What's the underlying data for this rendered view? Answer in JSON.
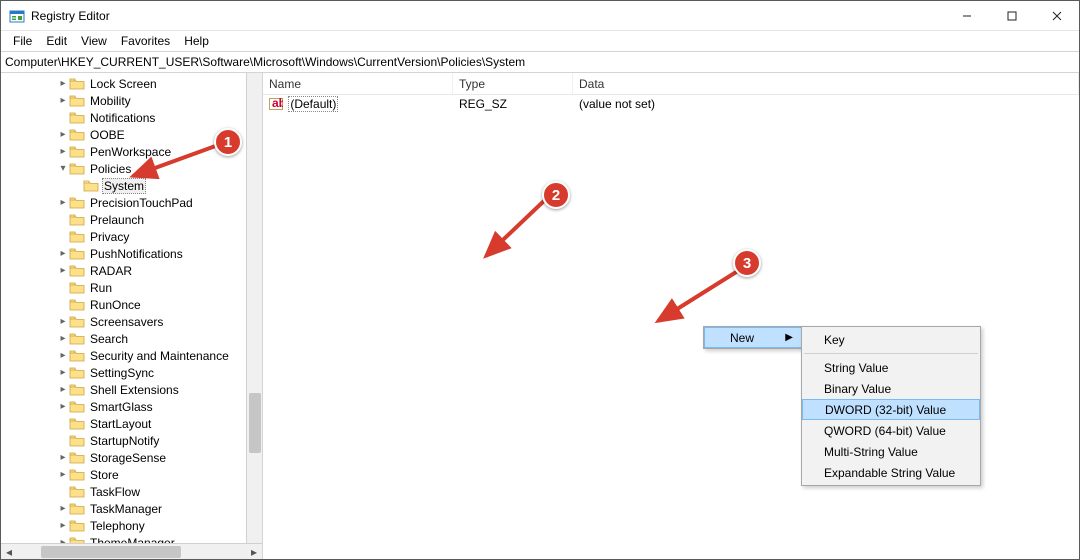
{
  "window": {
    "title": "Registry Editor"
  },
  "menu": {
    "items": [
      "File",
      "Edit",
      "View",
      "Favorites",
      "Help"
    ]
  },
  "address": {
    "path": "Computer\\HKEY_CURRENT_USER\\Software\\Microsoft\\Windows\\CurrentVersion\\Policies\\System"
  },
  "tree": {
    "items": [
      {
        "label": "Lock Screen",
        "depth": 4,
        "expander": ">"
      },
      {
        "label": "Mobility",
        "depth": 4,
        "expander": ">"
      },
      {
        "label": "Notifications",
        "depth": 4,
        "expander": ""
      },
      {
        "label": "OOBE",
        "depth": 4,
        "expander": ">"
      },
      {
        "label": "PenWorkspace",
        "depth": 4,
        "expander": ">"
      },
      {
        "label": "Policies",
        "depth": 4,
        "expander": "v"
      },
      {
        "label": "System",
        "depth": 5,
        "expander": "",
        "selected": true
      },
      {
        "label": "PrecisionTouchPad",
        "depth": 4,
        "expander": ">"
      },
      {
        "label": "Prelaunch",
        "depth": 4,
        "expander": ""
      },
      {
        "label": "Privacy",
        "depth": 4,
        "expander": ""
      },
      {
        "label": "PushNotifications",
        "depth": 4,
        "expander": ">"
      },
      {
        "label": "RADAR",
        "depth": 4,
        "expander": ">"
      },
      {
        "label": "Run",
        "depth": 4,
        "expander": ""
      },
      {
        "label": "RunOnce",
        "depth": 4,
        "expander": ""
      },
      {
        "label": "Screensavers",
        "depth": 4,
        "expander": ">"
      },
      {
        "label": "Search",
        "depth": 4,
        "expander": ">"
      },
      {
        "label": "Security and Maintenance",
        "depth": 4,
        "expander": ">"
      },
      {
        "label": "SettingSync",
        "depth": 4,
        "expander": ">"
      },
      {
        "label": "Shell Extensions",
        "depth": 4,
        "expander": ">"
      },
      {
        "label": "SmartGlass",
        "depth": 4,
        "expander": ">"
      },
      {
        "label": "StartLayout",
        "depth": 4,
        "expander": ""
      },
      {
        "label": "StartupNotify",
        "depth": 4,
        "expander": ""
      },
      {
        "label": "StorageSense",
        "depth": 4,
        "expander": ">"
      },
      {
        "label": "Store",
        "depth": 4,
        "expander": ">"
      },
      {
        "label": "TaskFlow",
        "depth": 4,
        "expander": ""
      },
      {
        "label": "TaskManager",
        "depth": 4,
        "expander": ">"
      },
      {
        "label": "Telephony",
        "depth": 4,
        "expander": ">"
      },
      {
        "label": "ThemeManager",
        "depth": 4,
        "expander": ">"
      }
    ]
  },
  "list": {
    "columns": {
      "name": "Name",
      "type": "Type",
      "data": "Data"
    },
    "rows": [
      {
        "name": "(Default)",
        "type": "REG_SZ",
        "data": "(value not set)"
      }
    ]
  },
  "context": {
    "primary": {
      "new": "New"
    },
    "sub": {
      "key": "Key",
      "string": "String Value",
      "binary": "Binary Value",
      "dword": "DWORD (32-bit) Value",
      "qword": "QWORD (64-bit) Value",
      "multistring": "Multi-String Value",
      "expandable": "Expandable String Value"
    }
  },
  "annotations": {
    "b1": "1",
    "b2": "2",
    "b3": "3"
  }
}
